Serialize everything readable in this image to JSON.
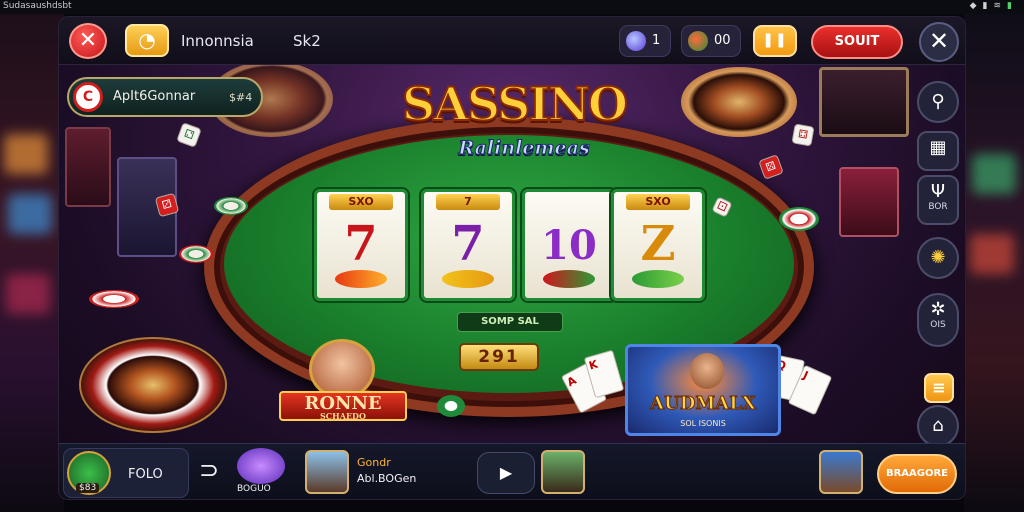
{
  "os_status": {
    "title": "Sudasaushdsbt",
    "icons": [
      "diamond-icon",
      "signal-icon",
      "wifi-icon",
      "battery-icon"
    ]
  },
  "topbar": {
    "close_glyph": "✕",
    "coin_glyph": "◔",
    "username": "Innonnsia",
    "code": "Sk2",
    "gems_value": "1",
    "coins_value": "00",
    "pause_glyph": "❚❚",
    "sout_label": "SOUIT",
    "exit_glyph": "✕"
  },
  "player": {
    "avatar_glyph": "C",
    "name": "ApIt6Gonnar",
    "score": "$#4"
  },
  "game": {
    "title": "SASSINO",
    "subtitle": "Ralinlemeas",
    "reels": [
      {
        "tag": "SXO",
        "symbol": "7",
        "symbol_color": "#c8151b"
      },
      {
        "tag": "7",
        "symbol": "7",
        "symbol_color": "#7a1fa8"
      },
      {
        "tag": "",
        "symbol": "10",
        "symbol_color": "#8c2cc7"
      },
      {
        "tag": "SXO",
        "symbol": "Z",
        "symbol_color": "#d88b0a"
      }
    ],
    "bet_label": "SOMP  SAL",
    "win_value": "291"
  },
  "promos": {
    "ronne_title": "RONNE",
    "ronne_sub": "SCHAEDO",
    "card_title": "AUDMALX",
    "card_sub": "SOL ISONIS"
  },
  "rail": {
    "search_glyph": "⚲",
    "grid_glyph": "▦",
    "mug_glyph": "Ψ",
    "mug_label": "BOR",
    "sun_glyph": "✺",
    "gear_glyph": "✲",
    "gear_label": "OIS",
    "menu_glyph": "≡",
    "home_glyph": "⌂"
  },
  "bottombar": {
    "folo_label": "FOLO",
    "folo_badge": "$83",
    "bracket_glyph": "⊃",
    "bogus_label": "BOGUO",
    "game_name": "Gondr",
    "game_code": "Abl.BOGen",
    "play_glyph": "▶",
    "cta_label": "BRAAGORE"
  },
  "colors": {
    "accent_red": "#d8201e",
    "accent_orange": "#f39a12",
    "felt_green": "#1a7f2c"
  }
}
